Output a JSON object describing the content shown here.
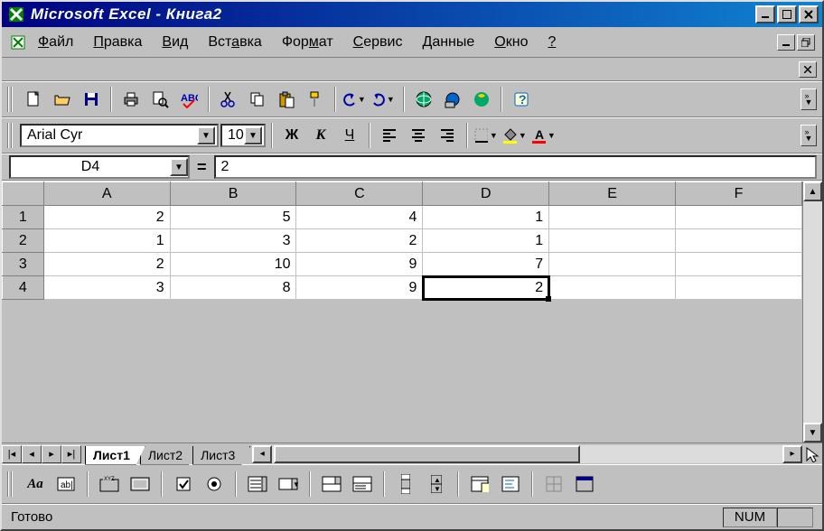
{
  "window": {
    "title": "Microsoft Excel - Книга2"
  },
  "menu": {
    "items": [
      "Файл",
      "Правка",
      "Вид",
      "Вставка",
      "Формат",
      "Сервис",
      "Данные",
      "Окно",
      "?"
    ]
  },
  "format": {
    "font_name": "Arial Cyr",
    "font_size": "10",
    "bold": "Ж",
    "italic": "К",
    "underline": "Ч"
  },
  "namebox": {
    "ref": "D4",
    "formula_prefix": "=",
    "formula_value": "2"
  },
  "grid": {
    "columns": [
      "A",
      "B",
      "C",
      "D",
      "E",
      "F"
    ],
    "row_headers": [
      "1",
      "2",
      "3",
      "4"
    ],
    "rows": [
      [
        "2",
        "5",
        "4",
        "1",
        "",
        ""
      ],
      [
        "1",
        "3",
        "2",
        "1",
        "",
        ""
      ],
      [
        "2",
        "10",
        "9",
        "7",
        "",
        ""
      ],
      [
        "3",
        "8",
        "9",
        "2",
        "",
        ""
      ]
    ],
    "selected": {
      "row": 3,
      "col": 3
    }
  },
  "tabs": {
    "items": [
      "Лист1",
      "Лист2",
      "Лист3"
    ],
    "active": 0
  },
  "status": {
    "ready": "Готово",
    "num": "NUM"
  }
}
